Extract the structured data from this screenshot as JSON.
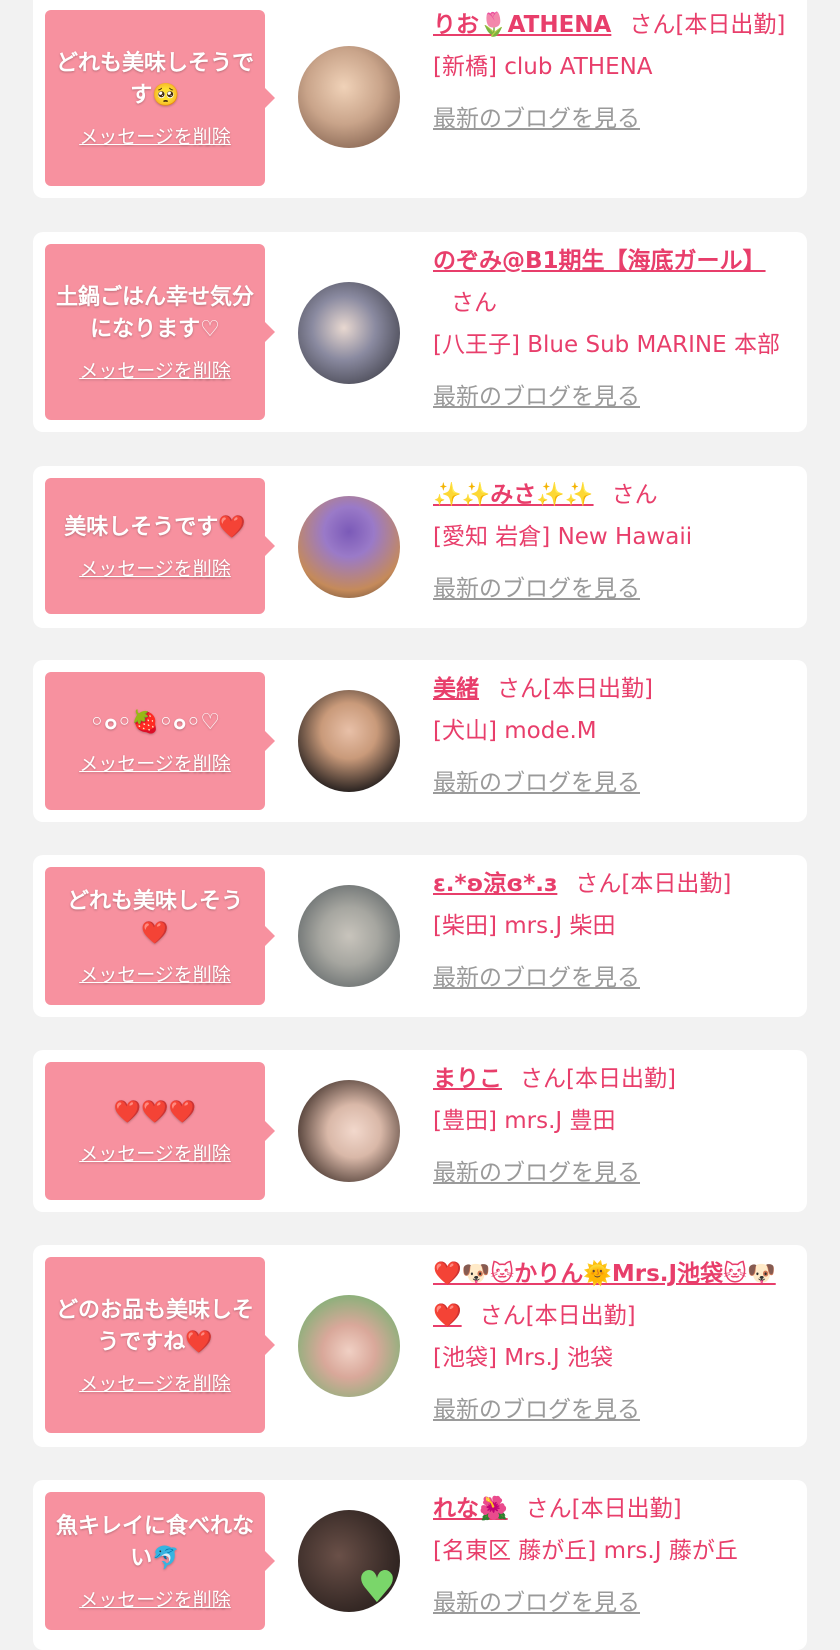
{
  "items": [
    {
      "message": "どれも美味しそうです🥺",
      "delete_label": "メッセージを削除",
      "name": "りお🌷ATHENA",
      "suffix": "さん[本日出勤]",
      "shop": "[新橋] club ATHENA",
      "blog_label": "最新のブログを見る",
      "avatar_colors": [
        "#c9a48a",
        "#6a4a3a"
      ]
    },
    {
      "message": "土鍋ごはん幸せ気分になります♡",
      "delete_label": "メッセージを削除",
      "name": "のぞみ@B1期生【海底ガール】",
      "suffix": "さん",
      "shop": "[八王子] Blue Sub MARINE 本部",
      "blog_label": "最新のブログを見る",
      "avatar_colors": [
        "#2a2a30",
        "#cfd3dc"
      ]
    },
    {
      "message": "美味しそうです❤️",
      "delete_label": "メッセージを削除",
      "name": "✨✨みさ✨✨",
      "suffix": "さん",
      "shop": "[愛知 岩倉] New Hawaii",
      "blog_label": "最新のブログを見る",
      "avatar_colors": [
        "#7b5ab8",
        "#c58a5a"
      ]
    },
    {
      "message": "◦๐◦🍓◦๐◦♡",
      "delete_label": "メッセージを削除",
      "name": "美緒",
      "suffix": "さん[本日出勤]",
      "shop": "[犬山] mode.M",
      "blog_label": "最新のブログを見る",
      "avatar_colors": [
        "#1e1a1a",
        "#c99a7a"
      ]
    },
    {
      "message": "どれも美味しそう❤️",
      "delete_label": "メッセージを削除",
      "name": "ε.*ʚ涼ɞ*.з",
      "suffix": "さん[本日出勤]",
      "shop": "[柴田] mrs.J 柴田",
      "blog_label": "最新のブログを見る",
      "avatar_colors": [
        "#a6a6a0",
        "#4c5458"
      ]
    },
    {
      "message": "❤️❤️❤️",
      "delete_label": "メッセージを削除",
      "name": "まりこ",
      "suffix": "さん[本日出勤]",
      "shop": "[豊田] mrs.J 豊田",
      "blog_label": "最新のブログを見る",
      "avatar_colors": [
        "#3a2a24",
        "#d9b8a8"
      ]
    },
    {
      "message": "どのお品も美味しそうですね❤️",
      "delete_label": "メッセージを削除",
      "name": "❤️🐶🐱かりん🌞Mrs.J池袋🐱🐶❤️",
      "suffix": "さん[本日出勤]",
      "shop": "[池袋] Mrs.J 池袋",
      "blog_label": "最新のブログを見る",
      "avatar_colors": [
        "#8bb07a",
        "#d9a89a"
      ]
    },
    {
      "message": "魚キレイに食べれない🐬",
      "delete_label": "メッセージを削除",
      "name": "れな🌺",
      "suffix": "さん[本日出勤]",
      "shop": "[名東区 藤が丘] mrs.J 藤が丘",
      "blog_label": "最新のブログを見る",
      "avatar_colors": [
        "#3a2c28",
        "#7ad66a"
      ]
    }
  ]
}
